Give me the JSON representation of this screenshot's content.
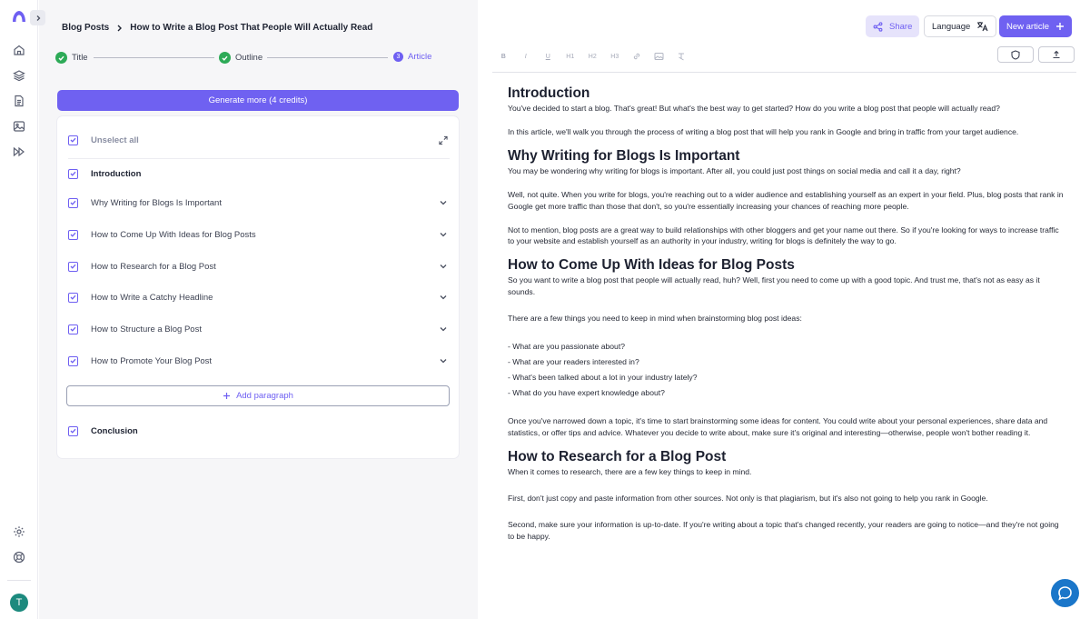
{
  "breadcrumb": {
    "root": "Blog Posts",
    "current": "How to Write a Blog Post That People Will Actually Read"
  },
  "steps": [
    {
      "label": "Title",
      "state": "done"
    },
    {
      "label": "Outline",
      "state": "done"
    },
    {
      "label": "Article",
      "number": "3",
      "state": "active"
    }
  ],
  "generate_button": "Generate more (4 credits)",
  "outline": {
    "unselect_all": "Unselect all",
    "introduction": "Introduction",
    "sections": [
      "Why Writing for Blogs Is Important",
      "How to Come Up With Ideas for Blog Posts",
      "How to Research for a Blog Post",
      "How to Write a Catchy Headline",
      "How to Structure a Blog Post",
      "How to Promote Your Blog Post"
    ],
    "add_paragraph": "Add paragraph",
    "conclusion": "Conclusion"
  },
  "header_buttons": {
    "share": "Share",
    "language": "Language",
    "new_article": "New article"
  },
  "toolbar": [
    "B",
    "I",
    "U",
    "H1",
    "H2",
    "H3"
  ],
  "avatar_initial": "T",
  "article": {
    "h_intro": "Introduction",
    "p_intro_1": "You've decided to start a blog. That's great! But what's the best way to get started? How do you write a blog post that people will actually read?",
    "p_intro_2": "In this article, we'll walk you through the process of writing a blog post that will help you rank in Google and bring in traffic from your target audience.",
    "h_why": "Why Writing for Blogs Is Important",
    "p_why_1": "You may be wondering why writing for blogs is important. After all, you could just post things on social media and call it a day, right?",
    "p_why_2": "Well, not quite. When you write for blogs, you're reaching out to a wider audience and establishing yourself as an expert in your field. Plus, blog posts that rank in Google get more traffic than those that don't, so you're essentially increasing your chances of reaching more people.",
    "p_why_3": "Not to mention, blog posts are a great way to build relationships with other bloggers and get your name out there. So if you're looking for ways to increase traffic to your website and establish yourself as an authority in your industry, writing for blogs is definitely the way to go.",
    "h_ideas": "How to Come Up With Ideas for Blog Posts",
    "p_ideas_1": "So you want to write a blog post that people will actually read, huh? Well, first you need to come up with a good topic. And trust me, that's not as easy as it sounds.",
    "p_ideas_2": "There are a few things you need to keep in mind when brainstorming blog post ideas:",
    "list": [
      "- What are you passionate about?",
      "- What are your readers interested in?",
      "- What's been talked about a lot in your industry lately?",
      "- What do you have expert knowledge about?"
    ],
    "p_ideas_3": "Once you've narrowed down a topic, it's time to start brainstorming some ideas for content. You could write about your personal experiences, share data and statistics, or offer tips and advice. Whatever you decide to write about, make sure it's original and interesting—otherwise, people won't bother reading it.",
    "h_research": "How to Research for a Blog Post",
    "p_research_1": "When it comes to research, there are a few key things to keep in mind.",
    "p_research_2": "First, don't just copy and paste information from other sources. Not only is that plagiarism, but it's also not going to help you rank in Google.",
    "p_research_3": "Second, make sure your information is up-to-date. If you're writing about a topic that's changed recently, your readers are going to notice—and they're not going to be happy."
  },
  "colors": {
    "accent": "#6f61f1",
    "success": "#2daa57",
    "chat": "#1a76c9"
  }
}
